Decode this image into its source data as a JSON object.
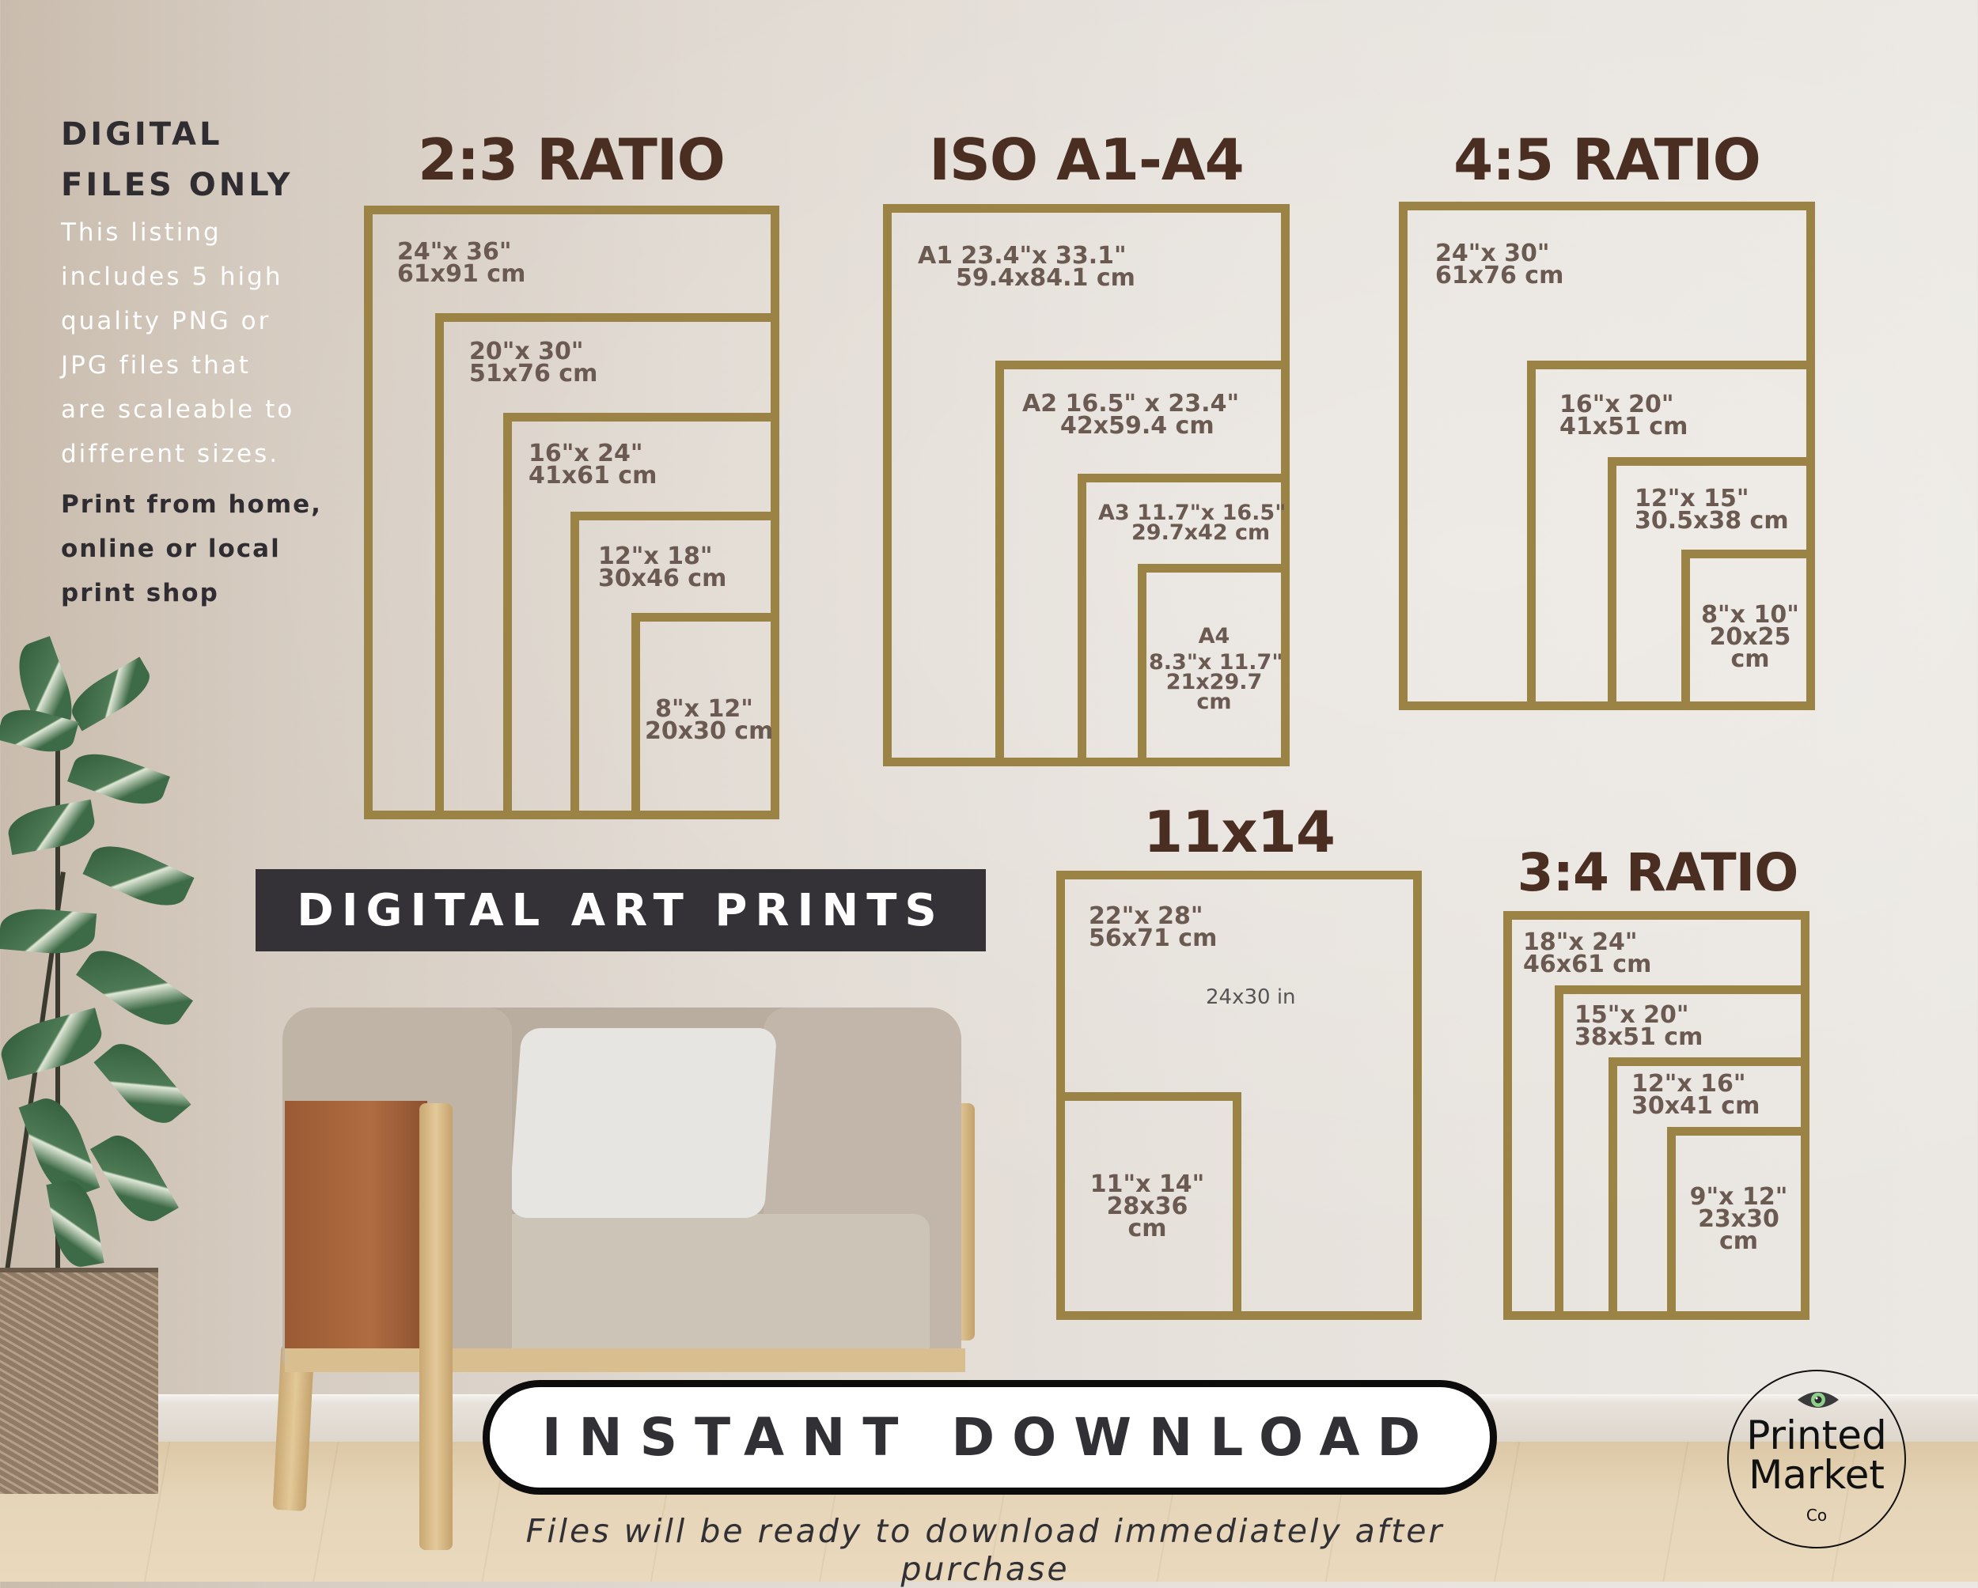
{
  "info": {
    "title_lines": [
      "DIGITAL",
      "FILES ONLY"
    ],
    "body_lines": [
      "This listing",
      "includes 5 high",
      "quality PNG or",
      "JPG files that",
      "are scaleable to",
      "different sizes."
    ],
    "cta_lines": [
      "Print from home,",
      "online or local",
      "print shop"
    ]
  },
  "groups": {
    "ratio_2_3": {
      "title": "2:3 RATIO",
      "sizes": [
        {
          "in": "24\"x 36\"",
          "cm": "61x91 cm"
        },
        {
          "in": "20\"x 30\"",
          "cm": "51x76 cm"
        },
        {
          "in": "16\"x 24\"",
          "cm": "41x61 cm"
        },
        {
          "in": "12\"x 18\"",
          "cm": "30x46 cm"
        },
        {
          "in": "8\"x 12\"",
          "cm": "20x30 cm"
        }
      ]
    },
    "iso": {
      "title": "ISO A1-A4",
      "sizes": [
        {
          "in": "A1 23.4\"x 33.1\"",
          "cm": "59.4x84.1 cm"
        },
        {
          "in": "A2 16.5\" x 23.4\"",
          "cm": "42x59.4 cm"
        },
        {
          "in": "A3 11.7\"x 16.5\"",
          "cm": "29.7x42 cm"
        },
        {
          "name": "A4",
          "in": "8.3\"x 11.7\"",
          "cm": "21x29.7",
          "unit": "cm"
        }
      ]
    },
    "ratio_4_5": {
      "title": "4:5 RATIO",
      "sizes": [
        {
          "in": "24\"x 30\"",
          "cm": "61x76 cm"
        },
        {
          "in": "16\"x 20\"",
          "cm": "41x51 cm"
        },
        {
          "in": "12\"x 15\"",
          "cm": "30.5x38 cm"
        },
        {
          "in": "8\"x 10\"",
          "cm": "20x25",
          "unit": "cm"
        }
      ]
    },
    "size_11x14": {
      "title": "11x14",
      "sizes": [
        {
          "in": "22\"x 28\"",
          "cm": "56x71 cm"
        },
        {
          "in": "11\"x 14\"",
          "cm": "28x36",
          "unit": "cm"
        }
      ],
      "note": "24x30 in"
    },
    "ratio_3_4": {
      "title": "3:4 RATIO",
      "sizes": [
        {
          "in": "18\"x 24\"",
          "cm": "46x61 cm"
        },
        {
          "in": "15\"x 20\"",
          "cm": "38x51 cm"
        },
        {
          "in": "12\"x 16\"",
          "cm": "30x41 cm"
        },
        {
          "in": "9\"x 12\"",
          "cm": "23x30",
          "unit": "cm"
        }
      ]
    }
  },
  "banner": {
    "label": "DIGITAL ART PRINTS"
  },
  "download": {
    "button_label": "INSTANT DOWNLOAD",
    "footnote": "Files will be ready to download immediately after purchase"
  },
  "logo": {
    "line1": "Printed",
    "line2": "Market",
    "line3": "Co",
    "icon": "eye-icon"
  },
  "colors": {
    "frame_gold": "#9a8345",
    "title_brown": "#4a2e22",
    "label_taupe": "#6b5a52",
    "banner_bg": "#343237",
    "eye_green": "#8fd08a"
  }
}
